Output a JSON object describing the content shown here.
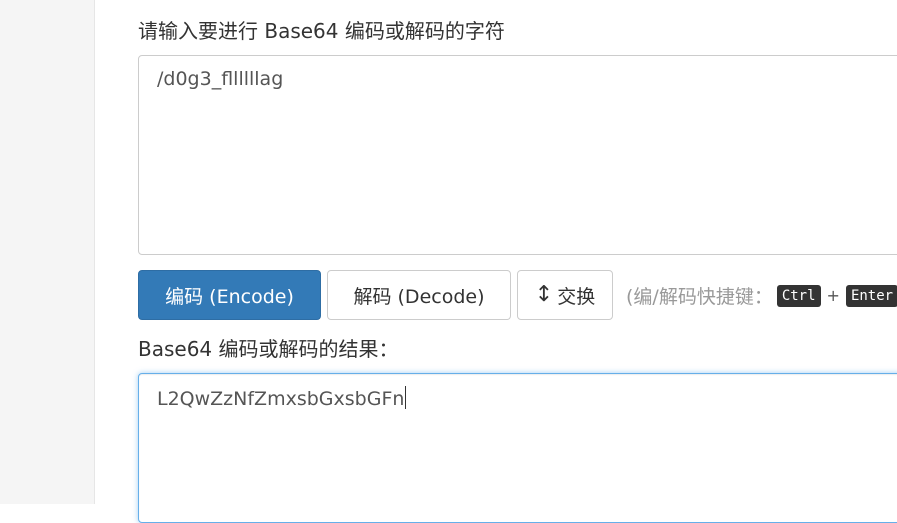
{
  "input_section": {
    "label": "请输入要进行 Base64 编码或解码的字符",
    "value": "/d0g3_fllllllag"
  },
  "actions": {
    "encode_label": "编码 (Encode)",
    "decode_label": "解码 (Decode)",
    "swap_label": "交换",
    "swap_icon": "↕",
    "shortcut_hint": "(编/解码快捷键：",
    "shortcut_key1": "Ctrl",
    "shortcut_plus": "+",
    "shortcut_key2": "Enter"
  },
  "output_section": {
    "label": "Base64 编码或解码的结果：",
    "value": "L2QwZzNfZmxsbGxsbGFn"
  },
  "colors": {
    "primary": "#337ab7",
    "focus_border": "#66afe9"
  }
}
